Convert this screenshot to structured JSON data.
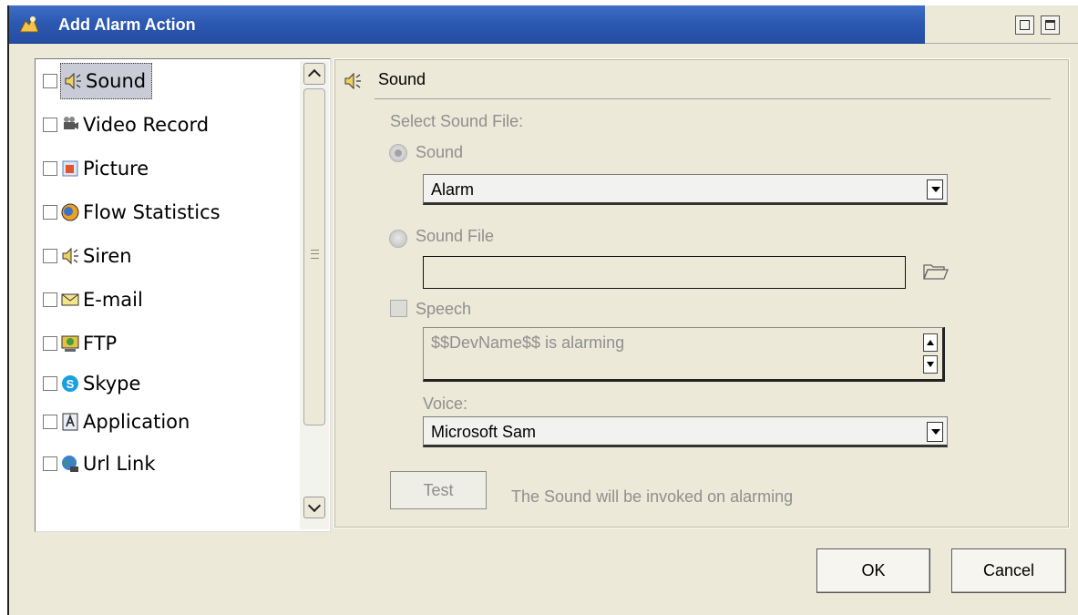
{
  "window": {
    "title": "Add Alarm Action"
  },
  "action_list": {
    "items": [
      {
        "label": "Sound",
        "icon": "speaker-icon",
        "checked": false,
        "selected": true
      },
      {
        "label": "Video Record",
        "icon": "video-camera-icon",
        "checked": false,
        "selected": false
      },
      {
        "label": "Picture",
        "icon": "picture-icon",
        "checked": false,
        "selected": false
      },
      {
        "label": "Flow Statistics",
        "icon": "flow-statistics-icon",
        "checked": false,
        "selected": false
      },
      {
        "label": "Siren",
        "icon": "speaker-icon",
        "checked": false,
        "selected": false
      },
      {
        "label": "E-mail",
        "icon": "envelope-icon",
        "checked": false,
        "selected": false
      },
      {
        "label": "FTP",
        "icon": "ftp-icon",
        "checked": false,
        "selected": false
      },
      {
        "label": "Skype",
        "icon": "skype-icon",
        "checked": false,
        "selected": false
      },
      {
        "label": "Application",
        "icon": "application-icon",
        "checked": false,
        "selected": false
      },
      {
        "label": "Url Link",
        "icon": "globe-icon",
        "checked": false,
        "selected": false
      }
    ]
  },
  "sound_panel": {
    "header": "Sound",
    "select_label": "Select Sound File:",
    "radio_sound_label": "Sound",
    "sound_combo_value": "Alarm",
    "radio_file_label": "Sound File",
    "sound_file_value": "",
    "speech_label": "Speech",
    "speech_text": "$$DevName$$ is alarming",
    "voice_label": "Voice:",
    "voice_combo_value": "Microsoft Sam",
    "test_label": "Test",
    "info_text": "The Sound will be invoked on alarming"
  },
  "buttons": {
    "ok": "OK",
    "cancel": "Cancel"
  },
  "colors": {
    "title_bar": "#2d59b3",
    "dialog_bg": "#ece9d8",
    "selection": "#c9cbd6",
    "disabled_text": "#8f8f8f"
  }
}
